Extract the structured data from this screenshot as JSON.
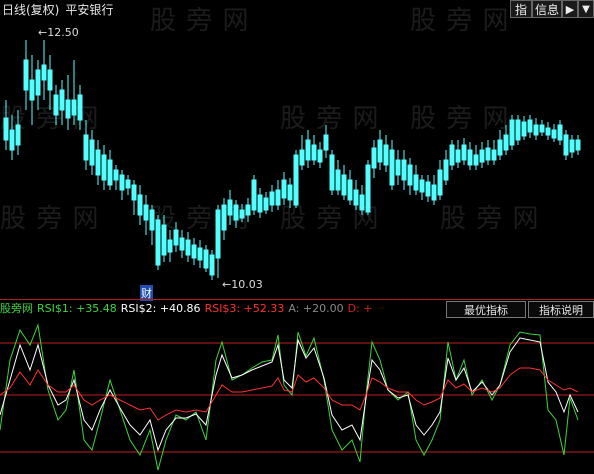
{
  "header": {
    "period_label": "日线(复权)",
    "stock_name": "平安银行",
    "btn_indicator": "指",
    "btn_info": "信息",
    "btn_arrow": "▶",
    "btn_down": "▼"
  },
  "watermark": "股 旁 网",
  "price_marks": {
    "high": "12.50",
    "low": "10.03"
  },
  "event_badge": "财",
  "indicator": {
    "name": "股旁网",
    "rsi1": "RSI$1: +35.48",
    "rsi2": "RSI$2: +40.86",
    "rsi3": "RSI$3: +52.33",
    "a": "A: +20.00",
    "d": "D: +",
    "btn_best": "最优指标",
    "btn_desc": "指标说明"
  },
  "colors": {
    "up": "#ff3b3b",
    "down": "#54ffff",
    "rsi1": "#3cd43c",
    "rsi2": "#ffffff",
    "rsi3": "#ff3030",
    "a": "#888888",
    "d": "#d02020"
  }
}
